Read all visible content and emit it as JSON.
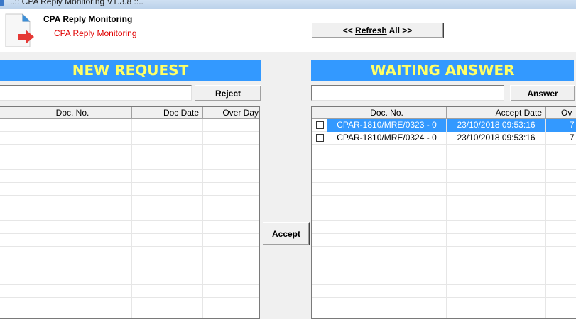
{
  "window": {
    "title": "..:: CPA Reply Monitoring V1.3.8 ::.."
  },
  "header": {
    "title": "CPA Reply Monitoring",
    "subtitle": "CPA Reply Monitoring",
    "refresh_label_prefix": "<< ",
    "refresh_label_main": "Refresh",
    "refresh_label_suffix": " All >>"
  },
  "left_panel": {
    "banner": "NEW REQUEST",
    "search_value": "",
    "reject_label": "Reject",
    "columns": [
      "Doc. No.",
      "Doc Date",
      "Over Day"
    ],
    "rows": []
  },
  "center": {
    "accept_label": "Accept"
  },
  "right_panel": {
    "banner": "WAITING ANSWER",
    "search_value": "",
    "answer_label": "Answer",
    "columns": [
      "Doc. No.",
      "Accept Date",
      "Ov"
    ],
    "rows": [
      {
        "doc_no": "CPAR-1810/MRE/0323 - 0",
        "accept_date": "23/10/2018 09:53:16",
        "over": "7",
        "checked": false,
        "selected": true
      },
      {
        "doc_no": "CPAR-1810/MRE/0324 - 0",
        "accept_date": "23/10/2018 09:53:16",
        "over": "7",
        "checked": false,
        "selected": false
      }
    ]
  },
  "colors": {
    "banner_bg": "#3399ff",
    "banner_text": "#ffff66",
    "subtitle": "#e00000",
    "selection": "#3399ff"
  }
}
